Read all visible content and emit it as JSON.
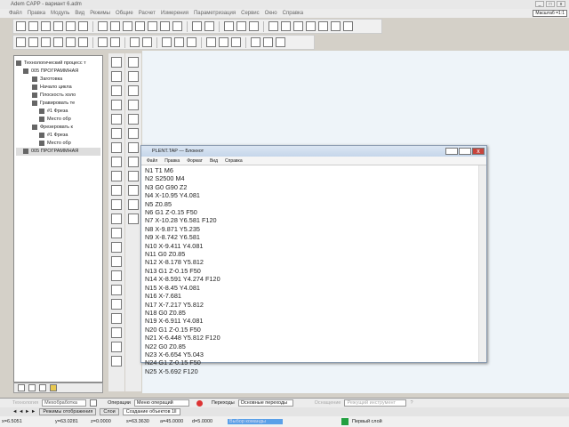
{
  "app": {
    "title": "Adem CAPP - вариант 6.adm",
    "scale": "Масштаб =1:1"
  },
  "menu": [
    "Файл",
    "Правка",
    "Модуль",
    "Вид",
    "Режимы",
    "Общие",
    "Расчет",
    "Измерения",
    "Параметризация",
    "Сервис",
    "Окно",
    "Справка"
  ],
  "tree": [
    "Технологический процесс т",
    "005 ПРОГРАММНАЯ",
    "Заготовка",
    "Начало цикла",
    "Плоскость холо",
    "Гравировать те",
    "#1 Фреза",
    "Место обр",
    "Фрезеровать к",
    "#1 Фреза",
    "Место обр",
    "005 ПРОГРАММНАЯ"
  ],
  "notepad": {
    "title": "PLENT.TAP — Блокнот",
    "menu": [
      "Файл",
      "Правка",
      "Формат",
      "Вид",
      "Справка"
    ],
    "lines": [
      "N1 T1 M6",
      "N2 S2500 M4",
      "N3 G0 G90 Z2",
      "N4 X-10.95 Y4.081",
      "N5 Z0.85",
      "N6 G1 Z-0.15 F50",
      "N7 X-10.28 Y6.581 F120",
      "N8 X-9.871 Y5.235",
      "N9 X-8.742 Y6.581",
      "N10 X-9.411 Y4.081",
      "N11 G0 Z0.85",
      "N12 X-8.178 Y5.812",
      "N13 G1 Z-0.15 F50",
      "N14 X-8.591 Y4.274 F120",
      "N15 X-8.45 Y4.081",
      "N16 X-7.681",
      "N17 X-7.217 Y5.812",
      "N18 G0 Z0.85",
      "N19 X-6.911 Y4.081",
      "N20 G1 Z-0.15 F50",
      "N21 X-6.448 Y5.812 F120",
      "N22 G0 Z0.85",
      "N23 X-6.654 Y5.043",
      "N24 G1 Z-0.15 F50",
      "N25 X-5.692 F120"
    ]
  },
  "opbar": {
    "type_label": "Технология",
    "type_value": "Мехобработка",
    "op_label": "Операции",
    "op_value": "Меню операций",
    "trans_label": "Переходы",
    "trans_value": "Основные переходы",
    "tool_label": "Оснащение",
    "tool_value": "Режущий инструмент"
  },
  "tabs": [
    "Режимы отображения",
    "Слои",
    "Создание объектов 1ll"
  ],
  "status": {
    "x": "x=6.5051",
    "y": "y=63.0281",
    "z": "z=0.0000",
    "s": "s=63.3630",
    "a": "a=45.0000",
    "d": "d=5.0000",
    "hint": "Выбор команды",
    "layer": "Первый слой"
  },
  "colors": {
    "canvas": "#eef4f9",
    "layer": "#22a040"
  }
}
